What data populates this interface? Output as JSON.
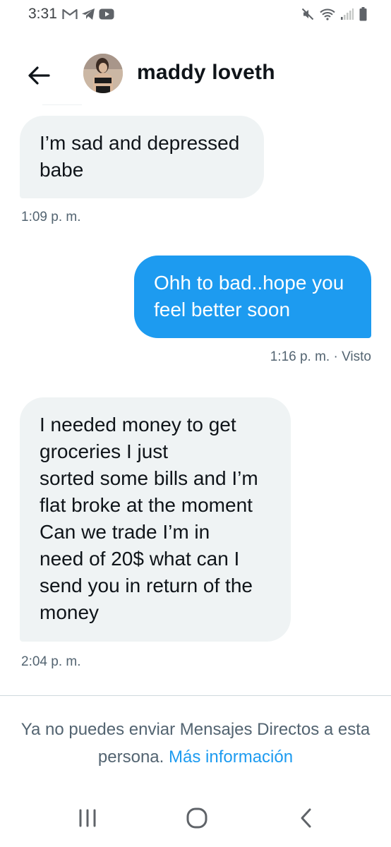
{
  "status_bar": {
    "time": "3:31",
    "notification_icons": [
      "gmail-icon",
      "telegram-icon",
      "youtube-icon"
    ],
    "system_icons": [
      "mute-icon",
      "wifi-icon",
      "signal-icon",
      "battery-icon"
    ]
  },
  "header": {
    "contact_name": "maddy loveth",
    "back_icon": "arrow-left-icon"
  },
  "messages": [
    {
      "direction": "incoming",
      "text": "I’m sad and depressed\nbabe",
      "timestamp": "1:09 p. m."
    },
    {
      "direction": "outgoing",
      "text": "Ohh to bad..hope you\nfeel better soon",
      "timestamp": "1:16 p. m. · Visto"
    },
    {
      "direction": "incoming",
      "text": "I needed money to get\ngroceries I just\nsorted some bills and I’m\nflat broke at the moment\nCan we trade I’m in\nneed of 20$ what can I\nsend you in return of the\nmoney",
      "timestamp": "2:04 p. m."
    }
  ],
  "footer": {
    "notice": "Ya no puedes enviar Mensajes Directos a esta persona.",
    "link": "Más información"
  },
  "nav_bar": {
    "buttons": [
      "recent-apps-icon",
      "home-icon",
      "back-icon"
    ]
  },
  "colors": {
    "accent": "#1d9bf0",
    "incoming_bubble": "#eff3f4",
    "secondary_text": "#536471"
  }
}
